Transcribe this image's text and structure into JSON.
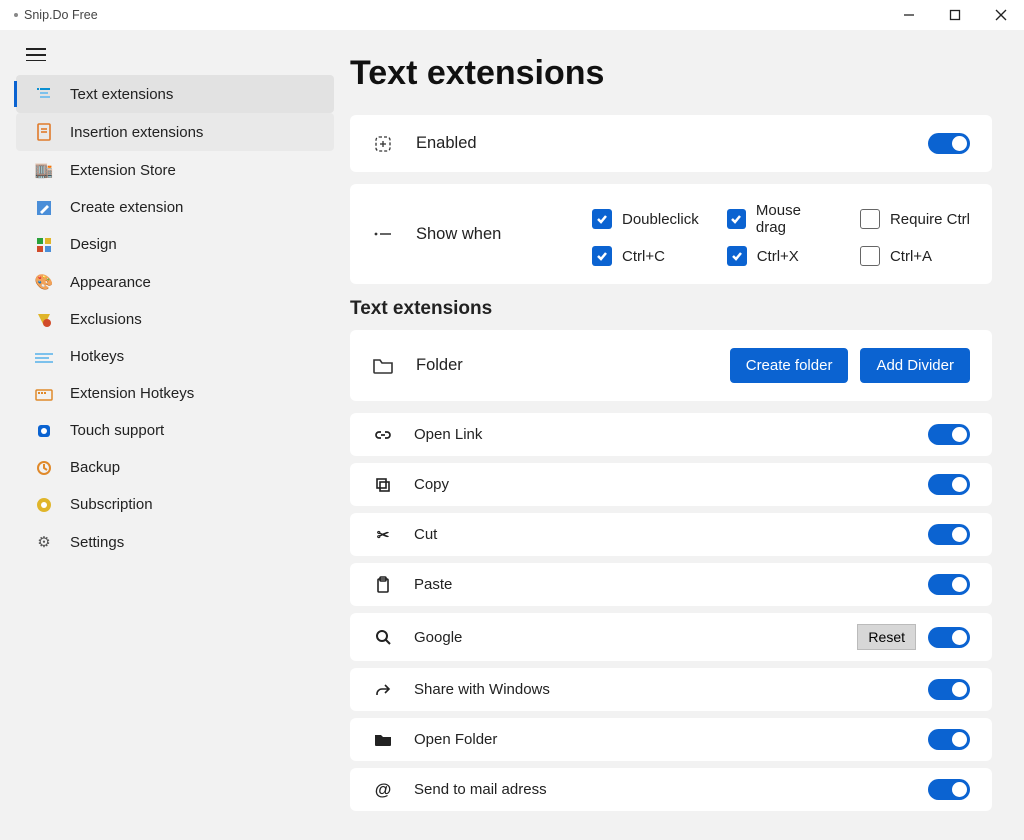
{
  "window": {
    "title": "Snip.Do Free"
  },
  "sidebar": {
    "items": [
      {
        "label": "Text extensions",
        "icon": "text",
        "active": true
      },
      {
        "label": "Insertion extensions",
        "icon": "insert",
        "hover": true
      },
      {
        "label": "Extension Store",
        "icon": "store"
      },
      {
        "label": "Create extension",
        "icon": "create"
      },
      {
        "label": "Design",
        "icon": "design"
      },
      {
        "label": "Appearance",
        "icon": "appearance"
      },
      {
        "label": "Exclusions",
        "icon": "exclusions"
      },
      {
        "label": "Hotkeys",
        "icon": "hotkeys"
      },
      {
        "label": "Extension Hotkeys",
        "icon": "exthotkeys"
      },
      {
        "label": "Touch support",
        "icon": "touch"
      },
      {
        "label": "Backup",
        "icon": "backup"
      },
      {
        "label": "Subscription",
        "icon": "subscription"
      },
      {
        "label": "Settings",
        "icon": "settings"
      }
    ]
  },
  "page": {
    "title": "Text extensions",
    "enabled": {
      "label": "Enabled",
      "on": true
    },
    "showWhen": {
      "label": "Show when",
      "options": [
        {
          "label": "Doubleclick",
          "checked": true
        },
        {
          "label": "Mouse drag",
          "checked": true
        },
        {
          "label": "Require Ctrl",
          "checked": false
        },
        {
          "label": "Ctrl+C",
          "checked": true
        },
        {
          "label": "Ctrl+X",
          "checked": true
        },
        {
          "label": "Ctrl+A",
          "checked": false
        }
      ]
    },
    "section": {
      "heading": "Text extensions",
      "folderLabel": "Folder",
      "createFolder": "Create folder",
      "addDivider": "Add Divider"
    },
    "extensions": [
      {
        "label": "Open Link",
        "icon": "link",
        "on": true
      },
      {
        "label": "Copy",
        "icon": "copy",
        "on": true
      },
      {
        "label": "Cut",
        "icon": "cut",
        "on": true
      },
      {
        "label": "Paste",
        "icon": "paste",
        "on": true
      },
      {
        "label": "Google",
        "icon": "search",
        "on": true,
        "reset": "Reset"
      },
      {
        "label": "Share with Windows",
        "icon": "share",
        "on": true
      },
      {
        "label": "Open Folder",
        "icon": "folder",
        "on": true
      },
      {
        "label": "Send to mail adress",
        "icon": "mail",
        "on": true
      }
    ]
  }
}
